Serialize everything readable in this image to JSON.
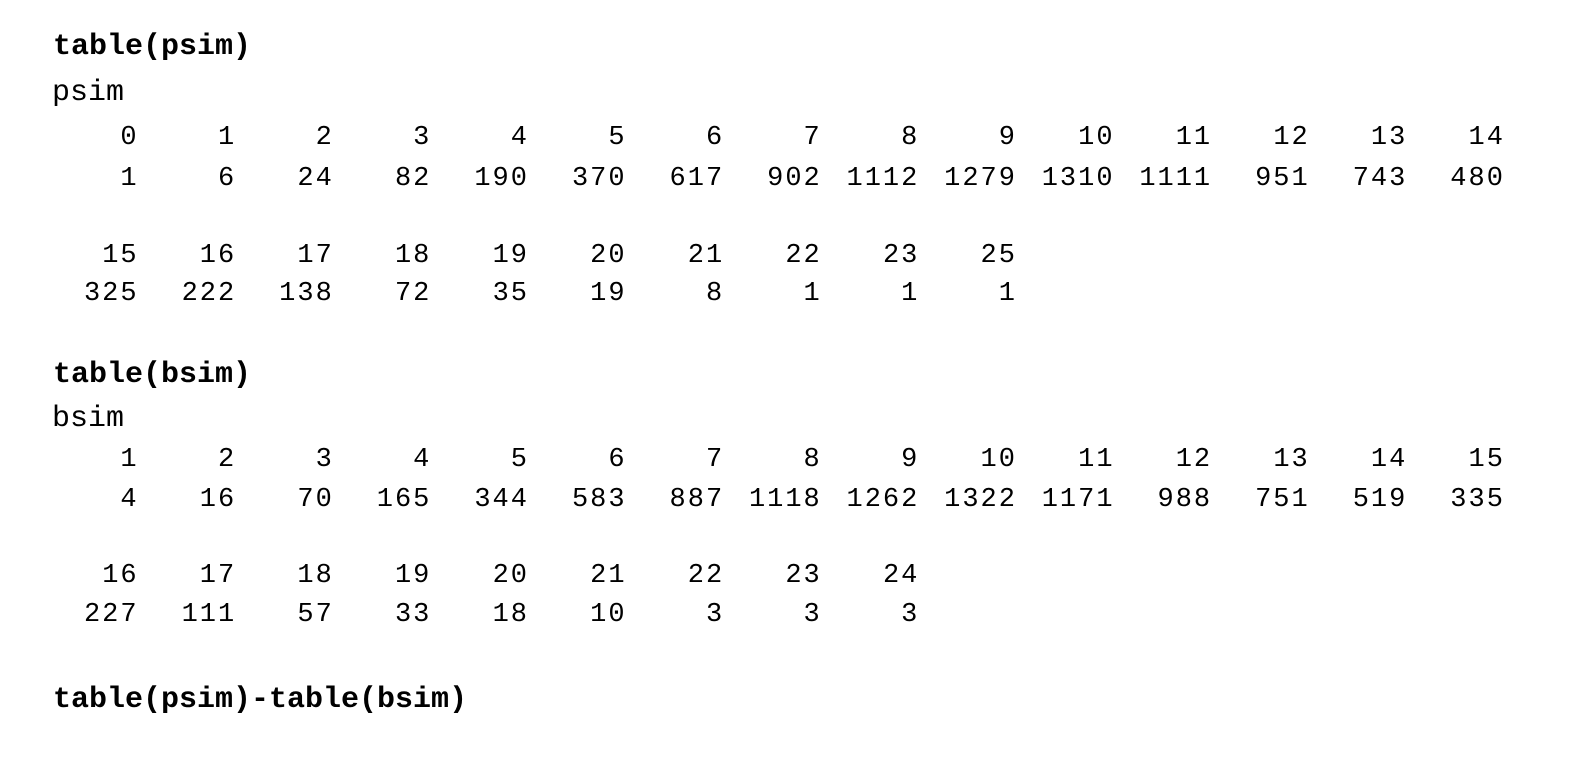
{
  "blocks": [
    {
      "command": "table(psim)",
      "varname": "psim",
      "rows": [
        [
          "0",
          "1",
          "2",
          "3",
          "4",
          "5",
          "6",
          "7",
          "8",
          "9",
          "10",
          "11",
          "12",
          "13",
          "14"
        ],
        [
          "1",
          "6",
          "24",
          "82",
          "190",
          "370",
          "617",
          "902",
          "1112",
          "1279",
          "1310",
          "1111",
          "951",
          "743",
          "480"
        ],
        [
          "15",
          "16",
          "17",
          "18",
          "19",
          "20",
          "21",
          "22",
          "23",
          "25"
        ],
        [
          "325",
          "222",
          "138",
          "72",
          "35",
          "19",
          "8",
          "1",
          "1",
          "1"
        ]
      ]
    },
    {
      "command": "table(bsim)",
      "varname": "bsim",
      "rows": [
        [
          "1",
          "2",
          "3",
          "4",
          "5",
          "6",
          "7",
          "8",
          "9",
          "10",
          "11",
          "12",
          "13",
          "14",
          "15"
        ],
        [
          "4",
          "16",
          "70",
          "165",
          "344",
          "583",
          "887",
          "1118",
          "1262",
          "1322",
          "1171",
          "988",
          "751",
          "519",
          "335"
        ],
        [
          "16",
          "17",
          "18",
          "19",
          "20",
          "21",
          "22",
          "23",
          "24"
        ],
        [
          "227",
          "111",
          "57",
          "33",
          "18",
          "10",
          "3",
          "3",
          "3"
        ]
      ]
    }
  ],
  "final_command": "table(psim)-table(bsim)"
}
